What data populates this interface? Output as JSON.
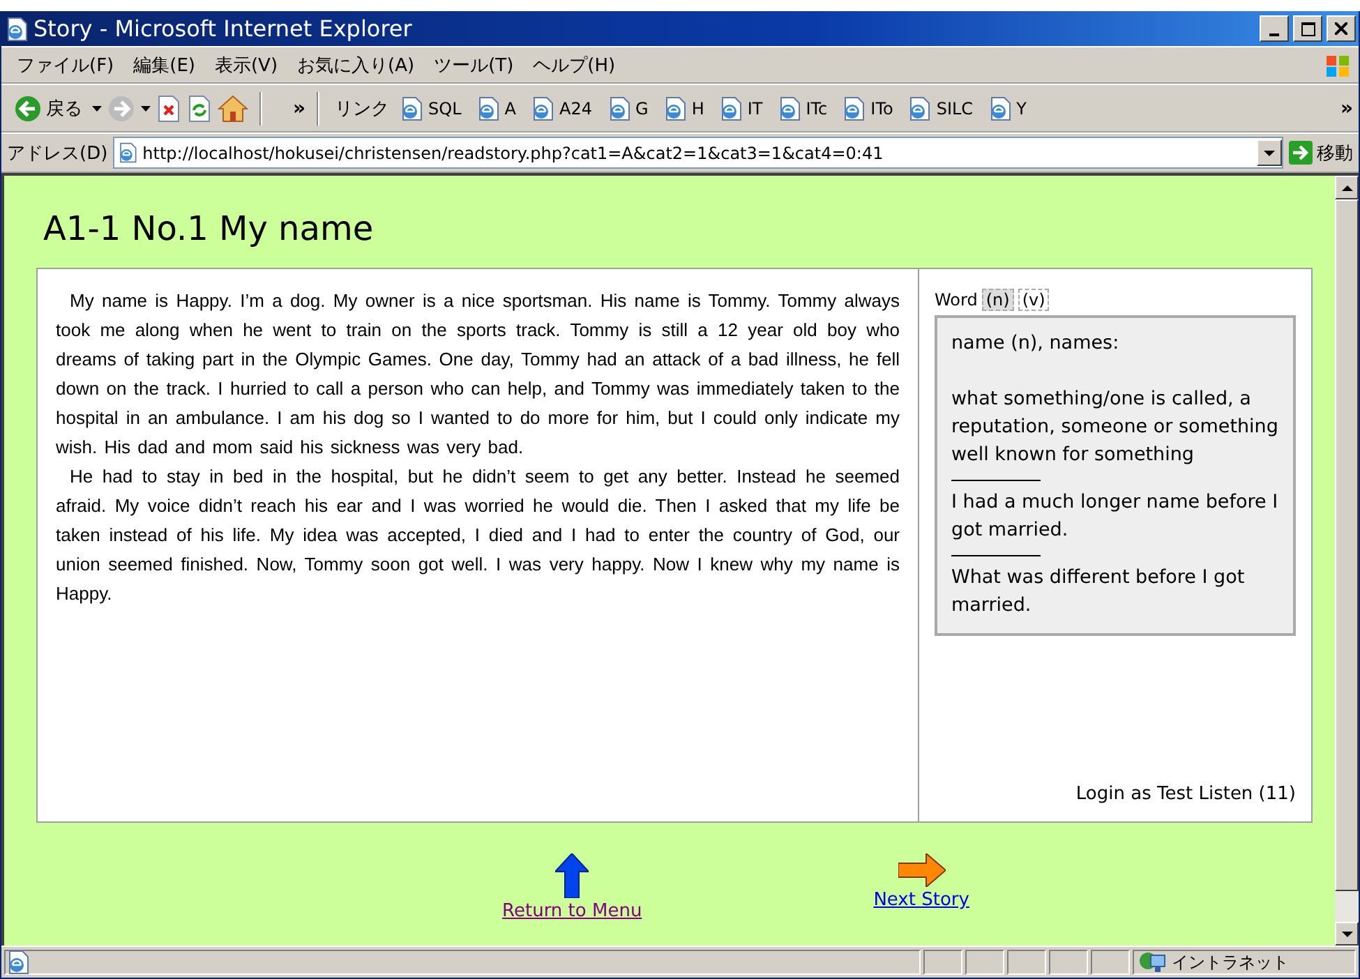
{
  "window": {
    "title": "Story - Microsoft Internet Explorer"
  },
  "menu": [
    {
      "label": "ファイル(F)"
    },
    {
      "label": "編集(E)"
    },
    {
      "label": "表示(V)"
    },
    {
      "label": "お気に入り(A)"
    },
    {
      "label": "ツール(T)"
    },
    {
      "label": "ヘルプ(H)"
    }
  ],
  "toolbar": {
    "back_label": "戻る",
    "chevron": "»",
    "links_label": "リンク",
    "links": [
      "SQL",
      "A",
      "A24",
      "G",
      "H",
      "IT",
      "ITc",
      "ITo",
      "SILC",
      "Y"
    ],
    "links_chevron": "»"
  },
  "address_bar": {
    "label": "アドレス(D)",
    "url": "http://localhost/hokusei/christensen/readstory.php?cat1=A&cat2=1&cat3=1&cat4=0:41",
    "go_label": "移動"
  },
  "page": {
    "heading": "A1-1 No.1 My name",
    "paragraphs": [
      "My name is Happy. I’m a dog. My owner is a nice sportsman. His name is Tommy. Tommy always took me along when he went to train on the sports track. Tommy is still a 12 year old boy who dreams of taking part in the Olympic Games. One day, Tommy had an attack of a bad illness, he fell down on the track. I hurried to call a person who can help, and Tommy was immediately taken to the hospital in an ambulance. I am his dog so I wanted to do more for him, but I could only indicate my wish. His dad and mom said his sickness was very bad.",
      "He had to stay in bed in the hospital, but he didn’t seem to get any better. Instead he seemed afraid. My voice didn’t reach his ear and I was worried he would die. Then I asked that my life be taken instead of his life. My idea was accepted, I died and I had to enter the country of God, our union seemed finished. Now, Tommy soon got well. I was very happy. Now I knew why my name is Happy."
    ],
    "word_panel": {
      "label": "Word",
      "tabs": [
        {
          "label": "(n)",
          "selected": true
        },
        {
          "label": "(v)",
          "selected": false
        }
      ],
      "definition": {
        "headword": "name (n), names:",
        "meaning": "what something/one is called, a reputation, someone or something well known for something",
        "examples": [
          "I had a much longer name before I got married.",
          "What was different before I got married."
        ]
      },
      "login": "Login as Test Listen (11)"
    },
    "nav_links": [
      {
        "kind": "up",
        "label": "Return to Menu",
        "visited": true
      },
      {
        "kind": "next",
        "label": "Next Story",
        "visited": false
      }
    ]
  },
  "status_bar": {
    "zone": "イントラネット"
  }
}
